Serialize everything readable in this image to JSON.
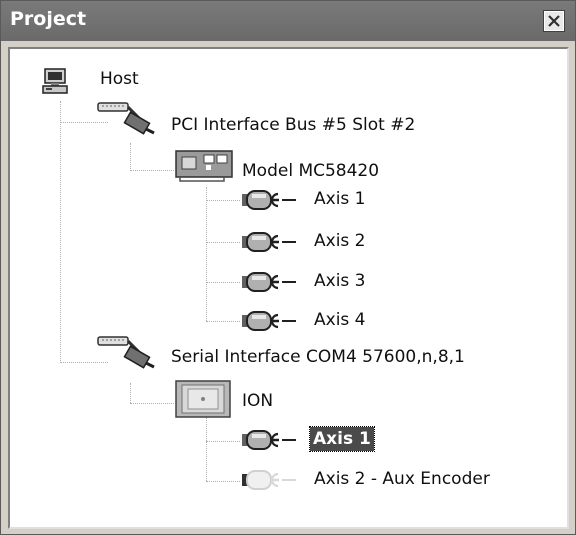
{
  "panel": {
    "title": "Project",
    "close_icon": "close-icon"
  },
  "tree": {
    "host": {
      "label": "Host",
      "icon": "computer-icon"
    },
    "pci_bus": {
      "label": "PCI Interface Bus #5 Slot #2",
      "icon": "interface-cable-icon"
    },
    "mc58420": {
      "label": "Model MC58420",
      "icon": "pci-card-icon"
    },
    "pci_axes": [
      {
        "label": "Axis 1",
        "icon": "axis-motor-icon"
      },
      {
        "label": "Axis 2",
        "icon": "axis-motor-icon"
      },
      {
        "label": "Axis 3",
        "icon": "axis-motor-icon"
      },
      {
        "label": "Axis 4",
        "icon": "axis-motor-icon"
      }
    ],
    "serial": {
      "label": "Serial Interface COM4 57600,n,8,1",
      "icon": "interface-cable-icon"
    },
    "ion": {
      "label": "ION",
      "icon": "ion-module-icon"
    },
    "ion_axes": [
      {
        "label": "Axis 1",
        "icon": "axis-motor-icon",
        "selected": true
      },
      {
        "label": "Axis 2 - Aux Encoder",
        "icon": "axis-motor-disabled-icon"
      }
    ]
  }
}
